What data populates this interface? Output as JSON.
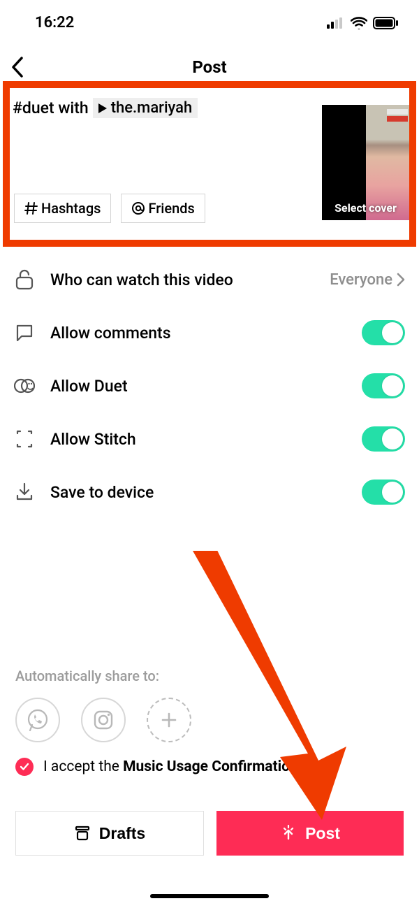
{
  "status_bar": {
    "time": "16:22"
  },
  "header": {
    "title": "Post"
  },
  "caption": {
    "prefix": "#duet with",
    "mention": "the.mariyah"
  },
  "chips": {
    "hashtags": "Hashtags",
    "friends": "Friends"
  },
  "thumbnail": {
    "cover_label": "Select cover"
  },
  "settings": {
    "privacy": {
      "label": "Who can watch this video",
      "value": "Everyone"
    },
    "comments": {
      "label": "Allow comments"
    },
    "duet": {
      "label": "Allow Duet"
    },
    "stitch": {
      "label": "Allow Stitch"
    },
    "save": {
      "label": "Save to device"
    }
  },
  "share": {
    "label": "Automatically share to:"
  },
  "accept": {
    "prefix": "I accept the ",
    "bold": "Music Usage Confirmation"
  },
  "buttons": {
    "drafts": "Drafts",
    "post": "Post"
  },
  "colors": {
    "highlight": "#ef3b00",
    "accent": "#fe2c55",
    "toggle_on": "#24dfa8"
  }
}
